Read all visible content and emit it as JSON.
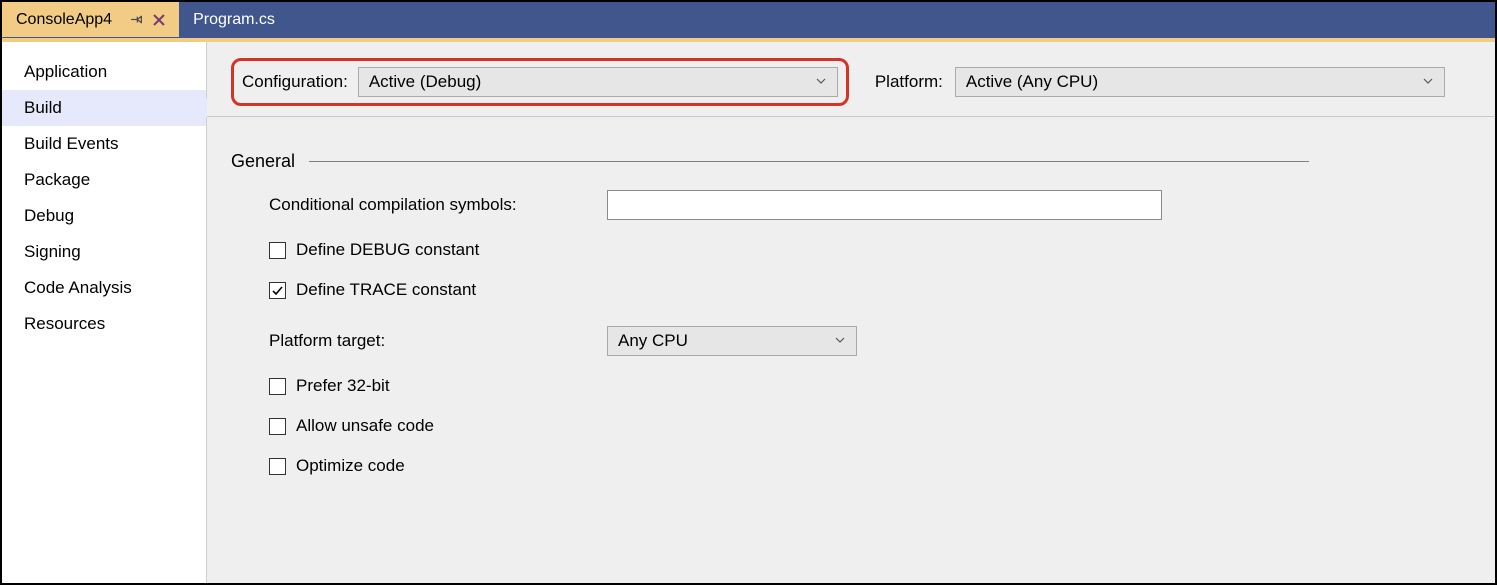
{
  "tabs": {
    "active": "ConsoleApp4",
    "other": "Program.cs"
  },
  "sidebar": {
    "items": [
      {
        "label": "Application"
      },
      {
        "label": "Build"
      },
      {
        "label": "Build Events"
      },
      {
        "label": "Package"
      },
      {
        "label": "Debug"
      },
      {
        "label": "Signing"
      },
      {
        "label": "Code Analysis"
      },
      {
        "label": "Resources"
      }
    ],
    "selected_index": 1
  },
  "top": {
    "config_label": "Configuration:",
    "config_value": "Active (Debug)",
    "platform_label": "Platform:",
    "platform_value": "Active (Any CPU)"
  },
  "section": {
    "general_title": "General",
    "conditional_label": "Conditional compilation symbols:",
    "conditional_value": "",
    "debug_constant_label": "Define DEBUG constant",
    "debug_constant_checked": false,
    "trace_constant_label": "Define TRACE constant",
    "trace_constant_checked": true,
    "platform_target_label": "Platform target:",
    "platform_target_value": "Any CPU",
    "prefer32_label": "Prefer 32-bit",
    "prefer32_checked": false,
    "unsafe_label": "Allow unsafe code",
    "unsafe_checked": false,
    "optimize_label": "Optimize code",
    "optimize_checked": false
  }
}
